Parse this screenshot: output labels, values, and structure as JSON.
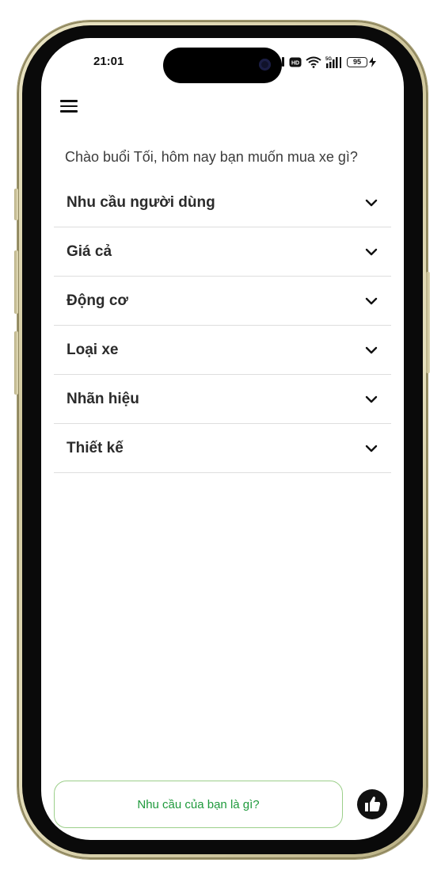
{
  "status_bar": {
    "time": "21:01",
    "hd_label": "HD",
    "network_label": "5G",
    "battery_level": "95"
  },
  "greeting": "Chào buổi Tối, hôm nay bạn muốn mua xe gì?",
  "filters": [
    {
      "label": "Nhu cầu người dùng",
      "icon": "chevron-down-icon"
    },
    {
      "label": "Giá cả",
      "icon": "chevron-down-icon"
    },
    {
      "label": "Động cơ",
      "icon": "chevron-down-icon"
    },
    {
      "label": "Loại xe",
      "icon": "chevron-down-icon"
    },
    {
      "label": "Nhãn hiệu",
      "icon": "chevron-down-icon"
    },
    {
      "label": "Thiết kế",
      "icon": "chevron-down-icon"
    }
  ],
  "input": {
    "placeholder": "Nhu cầu của bạn là gì?",
    "value": ""
  },
  "colors": {
    "accent_green": "#1f9a3c",
    "input_border": "#9ccf8a",
    "text_primary": "#2b2b2b"
  },
  "icons": {
    "menu": "menu-icon",
    "like": "thumbs-up-icon"
  }
}
